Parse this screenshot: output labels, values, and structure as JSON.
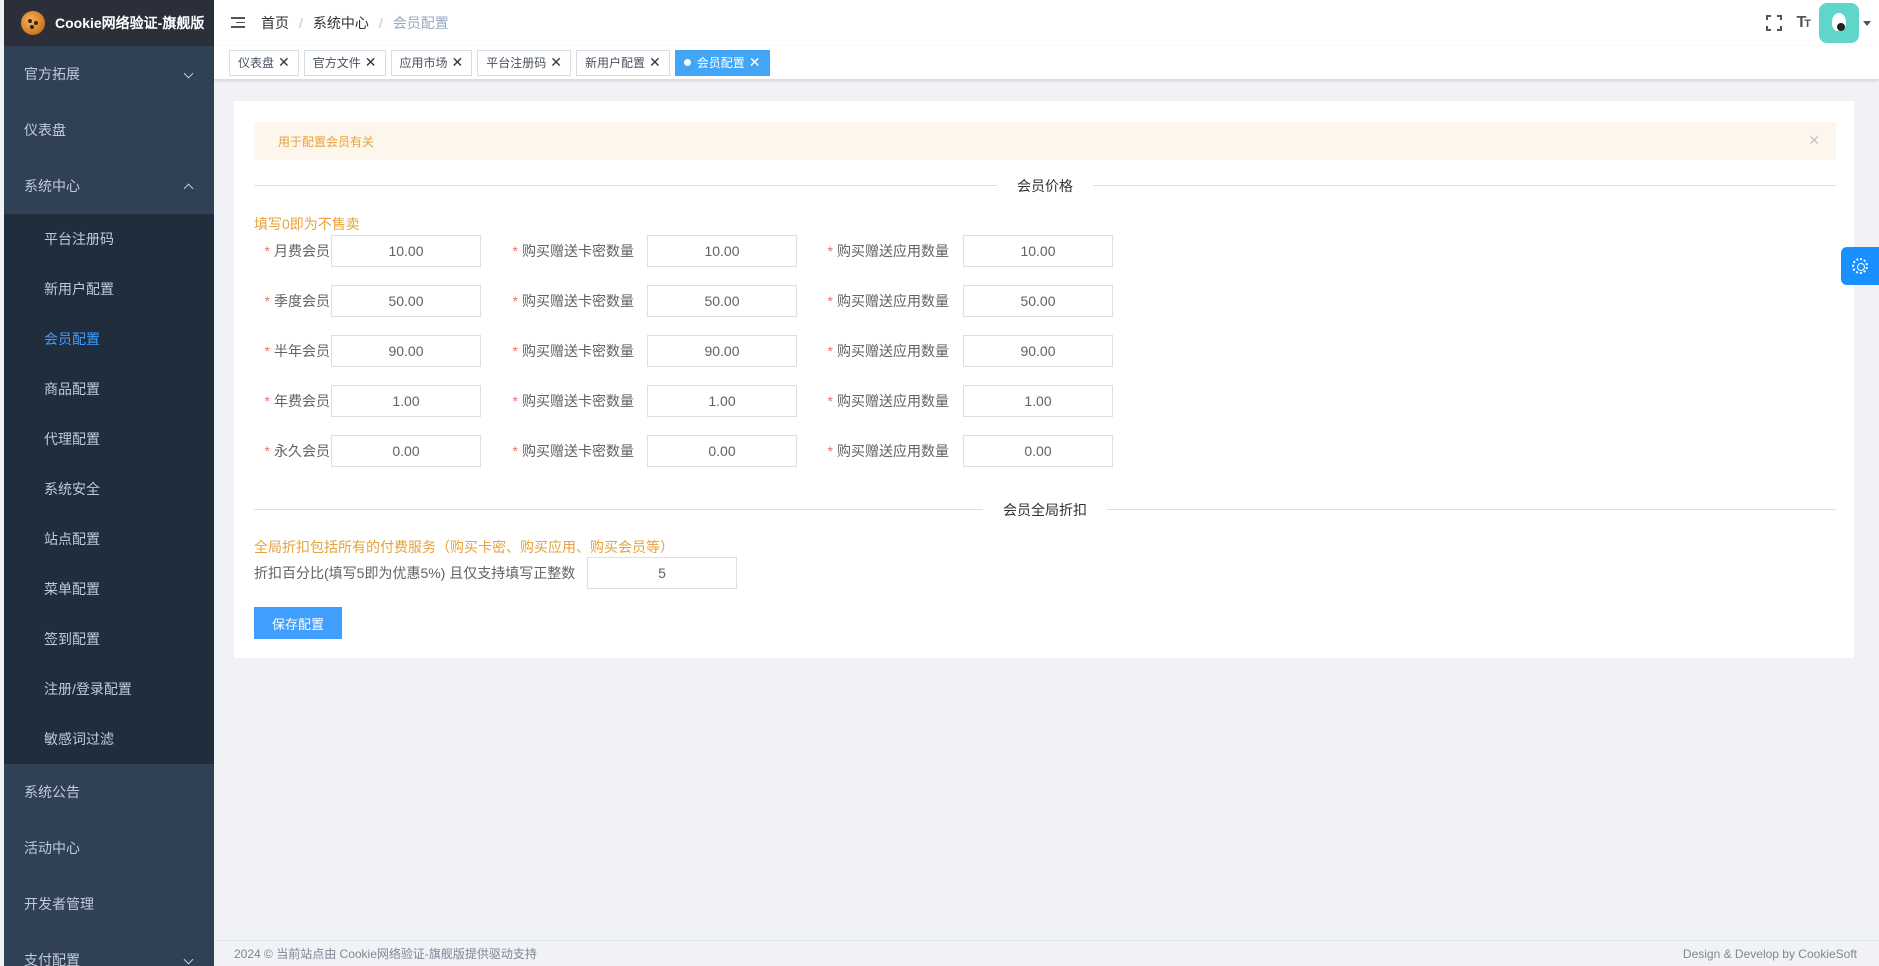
{
  "app": {
    "title": "Cookie网络验证-旗舰版"
  },
  "sidebar": {
    "items_top": [
      {
        "label": "官方拓展",
        "expandable": true
      },
      {
        "label": "仪表盘"
      },
      {
        "label": "系统中心",
        "expanded": true
      }
    ],
    "submenu": [
      {
        "label": "平台注册码"
      },
      {
        "label": "新用户配置"
      },
      {
        "label": "会员配置",
        "active": true
      },
      {
        "label": "商品配置"
      },
      {
        "label": "代理配置"
      },
      {
        "label": "系统安全"
      },
      {
        "label": "站点配置"
      },
      {
        "label": "菜单配置"
      },
      {
        "label": "签到配置"
      },
      {
        "label": "注册/登录配置"
      },
      {
        "label": "敏感词过滤"
      }
    ],
    "items_bottom": [
      {
        "label": "系统公告"
      },
      {
        "label": "活动中心"
      },
      {
        "label": "开发者管理"
      },
      {
        "label": "支付配置",
        "expandable": true
      }
    ]
  },
  "breadcrumb": [
    "首页",
    "系统中心",
    "会员配置"
  ],
  "tabs": [
    "仪表盘",
    "官方文件",
    "应用市场",
    "平台注册码",
    "新用户配置",
    "会员配置"
  ],
  "active_tab": "会员配置",
  "alert": {
    "text": "用于配置会员有关"
  },
  "section_price": {
    "title": "会员价格",
    "hint": "填写0即为不售卖",
    "card_label": "购买赠送卡密数量",
    "app_label": "购买赠送应用数量",
    "rows": [
      {
        "label": "月费会员",
        "price": "10.00",
        "cards": "10.00",
        "apps": "10.00"
      },
      {
        "label": "季度会员",
        "price": "50.00",
        "cards": "50.00",
        "apps": "50.00"
      },
      {
        "label": "半年会员",
        "price": "90.00",
        "cards": "90.00",
        "apps": "90.00"
      },
      {
        "label": "年费会员",
        "price": "1.00",
        "cards": "1.00",
        "apps": "1.00"
      },
      {
        "label": "永久会员",
        "price": "0.00",
        "cards": "0.00",
        "apps": "0.00"
      }
    ]
  },
  "section_discount": {
    "title": "会员全局折扣",
    "hint": "全局折扣包括所有的付费服务（购买卡密、购买应用、购买会员等）",
    "label": "折扣百分比(填写5即为优惠5%) 且仅支持填写正整数",
    "value": "5"
  },
  "save_button": "保存配置",
  "footer": {
    "left": "2024 © 当前站点由 Cookie网络验证-旗舰版提供驱动支持",
    "right": "Design & Develop by CookieSoft"
  },
  "colors": {
    "accent": "#409eff",
    "sidebar_bg": "#304156",
    "warning": "#e6a23c"
  }
}
